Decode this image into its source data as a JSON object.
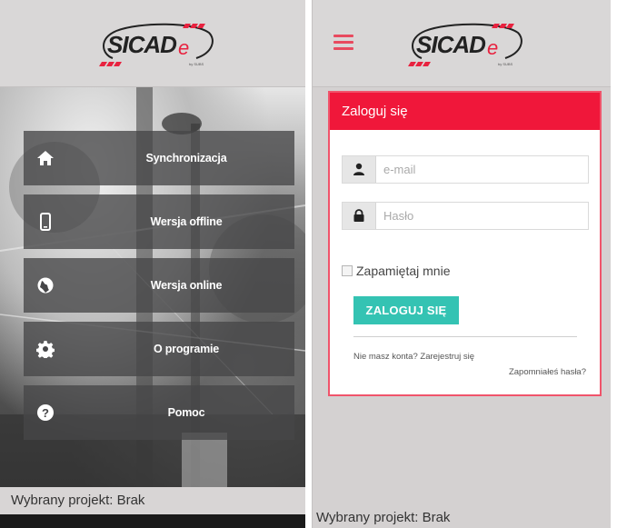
{
  "brand": {
    "logo_text": "SICADe",
    "logo_tagline": "by SUBS",
    "accent_color": "#f0173a",
    "teal_color": "#34c3b3"
  },
  "left_screen": {
    "menu": [
      {
        "label": "Synchronizacja",
        "icon": "home-icon"
      },
      {
        "label": "Wersja offline",
        "icon": "phone-icon"
      },
      {
        "label": "Wersja online",
        "icon": "globe-icon"
      },
      {
        "label": "O programie",
        "icon": "gear-icon"
      },
      {
        "label": "Pomoc",
        "icon": "question-icon"
      }
    ],
    "project_label": "Wybrany projekt: Brak"
  },
  "right_screen": {
    "login": {
      "title": "Zaloguj się",
      "email_placeholder": "e-mail",
      "password_placeholder": "Hasło",
      "remember_label": "Zapamiętaj mnie",
      "submit_label": "ZALOGUJ SIĘ",
      "register_text": "Nie masz konta? Zarejestruj się",
      "forgot_text": "Zapomniałeś hasła?"
    },
    "project_label": "Wybrany projekt: Brak"
  }
}
